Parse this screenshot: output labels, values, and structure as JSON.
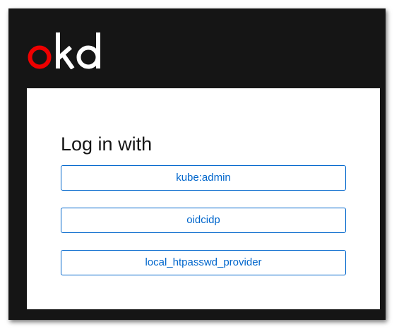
{
  "brand": {
    "logo_text": "okd",
    "logo_colors": {
      "o": "#ee0000",
      "kd": "#ffffff"
    }
  },
  "login": {
    "title": "Log in with",
    "providers": [
      {
        "label": "kube:admin"
      },
      {
        "label": "oidcidp"
      },
      {
        "label": "local_htpasswd_provider"
      }
    ]
  },
  "colors": {
    "window_background": "#151515",
    "card_background": "#ffffff",
    "button_accent": "#0066cc",
    "title_text": "#151515"
  }
}
